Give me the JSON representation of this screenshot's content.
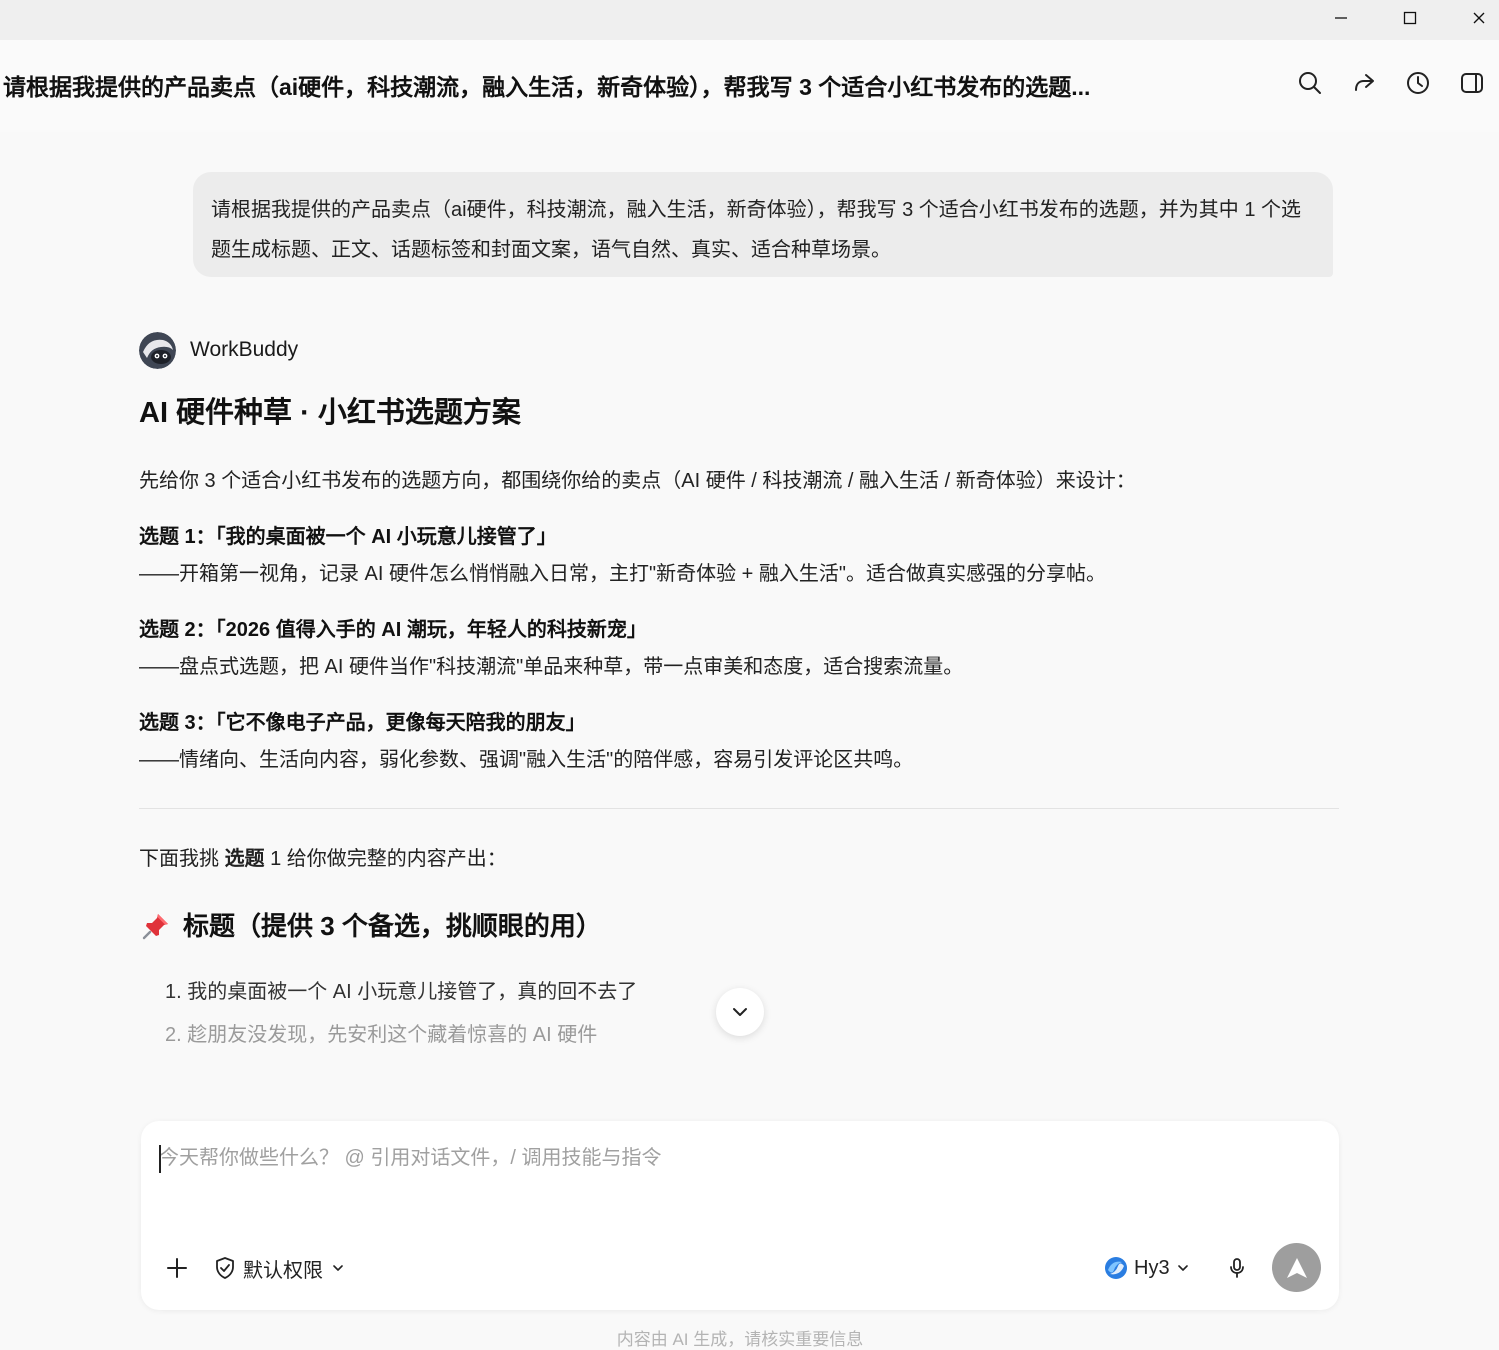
{
  "window": {
    "minimize_icon": "minimize-icon",
    "maximize_icon": "maximize-icon",
    "close_icon": "close-icon"
  },
  "header": {
    "title": "请根据我提供的产品卖点（ai硬件，科技潮流，融入生活，新奇体验），帮我写 3 个适合小红书发布的选题...",
    "icons": [
      "search-icon",
      "share-icon",
      "history-icon",
      "panel-icon"
    ]
  },
  "user_message": {
    "text": "请根据我提供的产品卖点（ai硬件，科技潮流，融入生活，新奇体验），帮我写 3 个适合小红书发布的选题，并为其中 1 个选题生成标题、正文、话题标签和封面文案，语气自然、真实、适合种草场景。"
  },
  "assistant": {
    "name": "WorkBuddy",
    "title": "AI 硬件种草 · 小红书选题方案",
    "intro": "先给你 3 个适合小红书发布的选题方向，都围绕你给的卖点（AI 硬件 / 科技潮流 / 融入生活 / 新奇体验）来设计：",
    "topics": [
      {
        "heading": "选题 1：「我的桌面被一个 AI 小玩意儿接管了」",
        "desc": "——开箱第一视角，记录 AI 硬件怎么悄悄融入日常，主打\"新奇体验 + 融入生活\"。适合做真实感强的分享帖。"
      },
      {
        "heading": "选题 2：「2026 值得入手的 AI 潮玩，年轻人的科技新宠」",
        "desc": "——盘点式选题，把 AI 硬件当作\"科技潮流\"单品来种草，带一点审美和态度，适合搜索流量。"
      },
      {
        "heading": "选题 3：「它不像电子产品，更像每天陪我的朋友」",
        "desc": "——情绪向、生活向内容，弱化参数、强调\"融入生活\"的陪伴感，容易引发评论区共鸣。"
      }
    ],
    "intro2_prefix": "下面我挑 ",
    "intro2_bold": "选题",
    "intro2_suffix": " 1 给你做完整的内容产出：",
    "section_heading": "标题（提供 3 个备选，挑顺眼的用）",
    "section_icon": "pushpin-icon",
    "titles": [
      "1. 我的桌面被一个 AI 小玩意儿接管了，真的回不去了",
      "2. 趁朋友没发现，先安利这个藏着惊喜的 AI 硬件"
    ]
  },
  "composer": {
    "placeholder": "今天帮你做些什么？ @ 引用对话文件，/ 调用技能与指令",
    "permission_label": "默认权限",
    "model_label": "Hy3"
  },
  "disclaimer": "内容由 AI 生成，请核实重要信息",
  "colors": {
    "background": "#f9f9f9",
    "bubble": "#ececec",
    "send_button": "#9e9e9e"
  }
}
